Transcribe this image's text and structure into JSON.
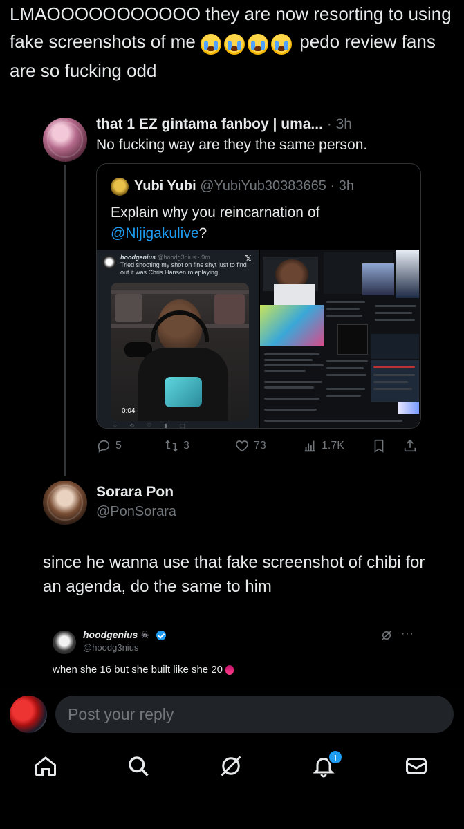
{
  "main_post": {
    "text": "LMAOOOOOOOOOOO they are now resorting to using fake screenshots of me",
    "text_after_emoji": "pedo review fans are so fucking odd",
    "emoji": "loudly-crying-face",
    "emoji_count": 4
  },
  "reply": {
    "name": "that 1 EZ gintama fanboy | uma...",
    "time": "3h",
    "text": "No fucking way are they the same person."
  },
  "quote": {
    "name": "Yubi Yubi",
    "handle": "@YubiYub30383665",
    "time": "3h",
    "text": "Explain why you reincarnation of",
    "mention": "@Nljigakulive",
    "text_end": "?",
    "media_left": {
      "name": "hoodgenius",
      "handle": "@hoodg3nius · 9m",
      "caption": "Tried shooting my shot on fine shyt just to find out it was Chris Hansen roleplaying",
      "video_time": "0:04"
    }
  },
  "actions": {
    "replies": "5",
    "reposts": "3",
    "likes": "73",
    "views": "1.7K"
  },
  "post": {
    "author_name": "Sorara Pon",
    "author_handle": "@PonSorara",
    "text": "since he wanna use that fake screenshot of chibi for an agenda, do the same to him"
  },
  "embed": {
    "name": "hoodgenius",
    "handle": "@hoodg3nius",
    "text": "when she 16 but she built like she 20"
  },
  "reply_bar": {
    "placeholder": "Post your reply"
  },
  "nav": {
    "notification_count": "1",
    "items": [
      "home-icon",
      "search-icon",
      "grok-icon",
      "notifications-icon",
      "messages-icon"
    ]
  },
  "colors": {
    "background": "#000000",
    "text": "#e7e9ea",
    "muted": "#71767b",
    "accent": "#1d9bf0",
    "border": "#2f3336"
  }
}
